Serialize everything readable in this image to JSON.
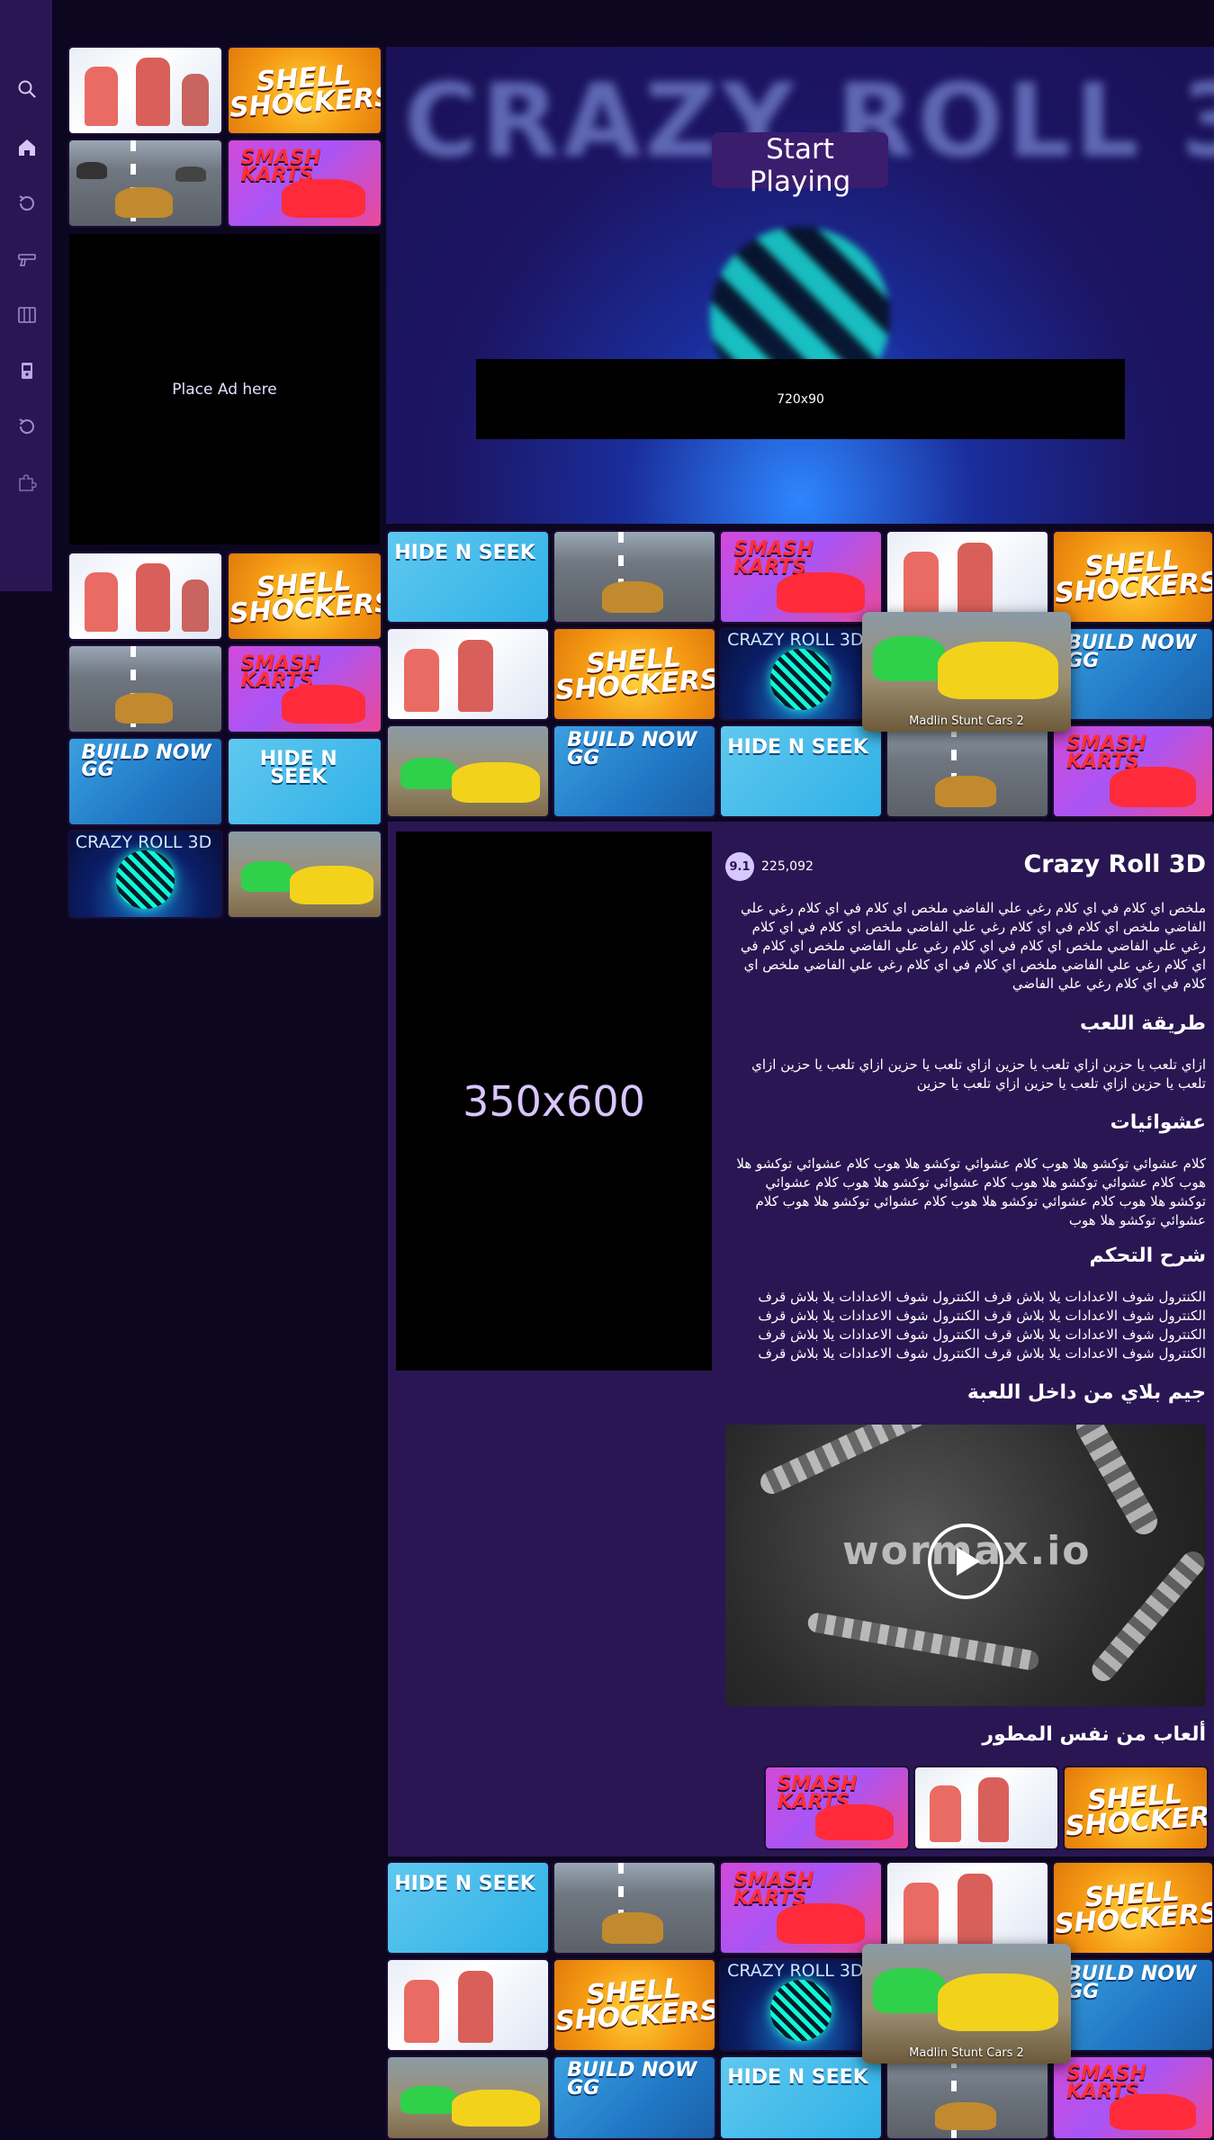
{
  "sidebar": {
    "icons": [
      "search-icon",
      "home-icon",
      "recent-icon",
      "gun-icon",
      "map-icon",
      "arcade-icon",
      "refresh-icon",
      "puzzle-icon"
    ]
  },
  "hero": {
    "title": "CRAZY ROLL 3D",
    "start_label": "Start Playing",
    "ad_label": "720x90"
  },
  "left_ad": {
    "label": "Place Ad here"
  },
  "tiles": {
    "shell": "SHELL SHOCKERS",
    "kart": "SMASH KARTS",
    "build": "BUILD NOW GG",
    "hide": "HIDE N SEEK",
    "roll": "CRAZY ROLL 3D"
  },
  "popup": {
    "label": "Madlin Stunt Cars 2"
  },
  "game": {
    "title": "Crazy Roll 3D",
    "rating": "9.1",
    "plays": "225,092",
    "description": "ملخص اي كلام في اي كلام رغي علي الفاضي ملخص اي كلام في اي كلام رغي علي الفاضي ملخص اي كلام في اي كلام رغي علي الفاضي ملخص اي كلام في اي كلام رغي علي الفاضي ملخص اي كلام في اي كلام رغي علي الفاضي ملخص اي كلام في اي كلام رغي علي الفاضي ملخص اي كلام في اي كلام رغي علي الفاضي ملخص اي كلام في اي كلام رغي علي الفاضي",
    "howto_title": "طريقة اللعب",
    "howto_text": "ازاي تلعب يا حزين ازاي تلعب يا حزين ازاي تلعب يا حزين ازاي تلعب يا حزين ازاي تلعب يا حزين ازاي تلعب يا حزين ازاي تلعب يا حزين",
    "random_title": "عشوائيات",
    "random_text": "كلام عشوائي توكشو هلا هوب كلام عشوائي توكشو هلا هوب كلام عشوائي توكشو هلا هوب كلام عشوائي توكشو هلا هوب كلام عشوائي توكشو هلا هوب كلام عشوائي توكشو هلا هوب كلام عشوائي توكشو هلا هوب كلام عشوائي توكشو هلا هوب كلام عشوائي توكشو هلا هوب",
    "controls_title": "شرح التحكم",
    "controls_text": "الكنترول شوف الاعدادات يلا بلاش قرف الكنترول شوف الاعدادات يلا بلاش قرف الكنترول شوف الاعدادات يلا بلاش قرف الكنترول شوف الاعدادات يلا بلاش قرف الكنترول شوف الاعدادات يلا بلاش قرف الكنترول شوف الاعدادات يلا بلاش قرف الكنترول شوف الاعدادات يلا بلاش قرف الكنترول شوف الاعدادات يلا بلاش قرف",
    "gameplay_title": "جيم بلاي من داخل اللعبة",
    "video_logo": "wormax.io",
    "same_dev_title": "ألعاب من نفس المطور"
  },
  "side_ad": {
    "label": "350x600"
  },
  "colors": {
    "bg": "#0d0620",
    "panel": "#2a1653",
    "accent": "#d7c7ff"
  }
}
